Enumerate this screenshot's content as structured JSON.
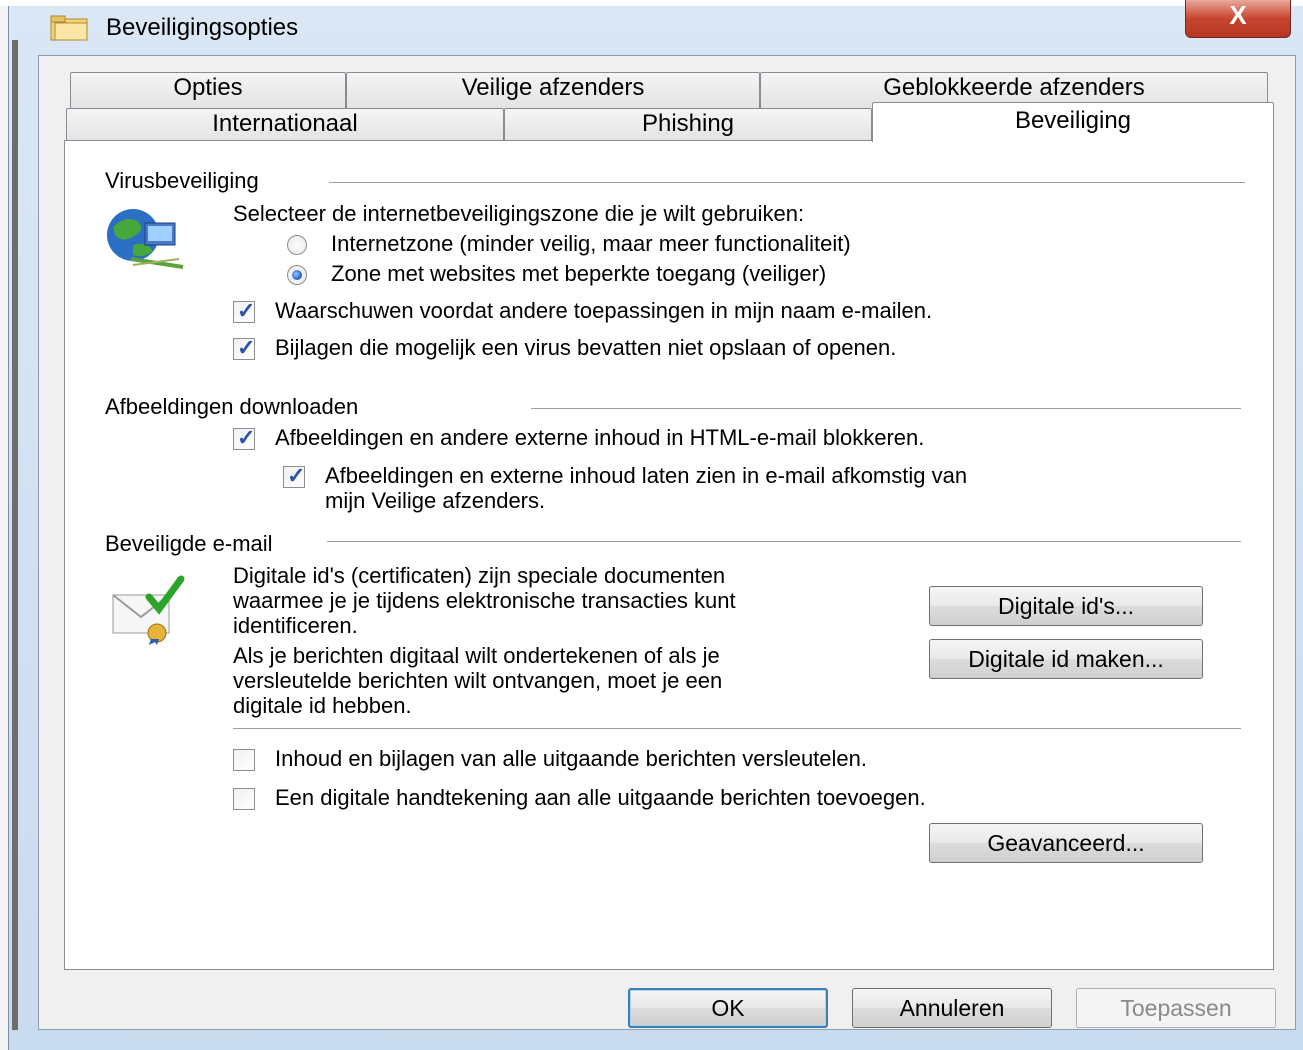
{
  "window": {
    "title": "Beveiligingsopties",
    "close_label": "X"
  },
  "tabs": {
    "row1": [
      "Opties",
      "Veilige afzenders",
      "Geblokkeerde afzenders"
    ],
    "row2": [
      "Internationaal",
      "Phishing",
      "Beveiliging"
    ],
    "active": "Beveiliging"
  },
  "virus": {
    "title": "Virusbeveiliging",
    "zone_prompt": "Selecteer de internetbeveiligingszone die je wilt gebruiken:",
    "radio_internet": "Internetzone (minder veilig, maar meer functionaliteit)",
    "radio_restricted": "Zone met websites met beperkte toegang (veiliger)",
    "selected_zone": "restricted",
    "check_warn": "Waarschuwen voordat andere toepassingen in mijn naam e-mailen.",
    "check_warn_checked": true,
    "check_attach": "Bijlagen die mogelijk een virus bevatten niet opslaan of openen.",
    "check_attach_checked": true
  },
  "images": {
    "title": "Afbeeldingen downloaden",
    "check_block": "Afbeeldingen en andere externe inhoud in HTML-e-mail blokkeren.",
    "check_block_checked": true,
    "check_safe_line1": "Afbeeldingen en externe inhoud laten zien in e-mail afkomstig van",
    "check_safe_line2": "mijn Veilige afzenders.",
    "check_safe_checked": true
  },
  "secure_mail": {
    "title": "Beveiligde e-mail",
    "desc1_line1": "Digitale id's (certificaten) zijn speciale documenten",
    "desc1_line2": "waarmee je je tijdens elektronische transacties kunt",
    "desc1_line3": "identificeren.",
    "desc2_line1": "Als je berichten digitaal wilt ondertekenen of als je",
    "desc2_line2": "versleutelde berichten wilt ontvangen, moet je een",
    "desc2_line3": "digitale id hebben.",
    "btn_ids": "Digitale id's...",
    "btn_make_id": "Digitale id maken...",
    "check_encrypt": "Inhoud en bijlagen van alle uitgaande berichten versleutelen.",
    "check_encrypt_checked": false,
    "check_sign": "Een digitale handtekening aan alle uitgaande berichten toevoegen.",
    "check_sign_checked": false,
    "btn_advanced": "Geavanceerd..."
  },
  "footer": {
    "ok": "OK",
    "cancel": "Annuleren",
    "apply": "Toepassen"
  },
  "colors": {
    "frame": "#c9dbee",
    "close": "#c7452e",
    "check_mark": "#2a52a8",
    "default_button_border": "#3c7fb1"
  },
  "icons": {
    "title": "folder-icon",
    "virus": "globe-network-icon",
    "secure_mail": "certificate-envelope-icon"
  }
}
